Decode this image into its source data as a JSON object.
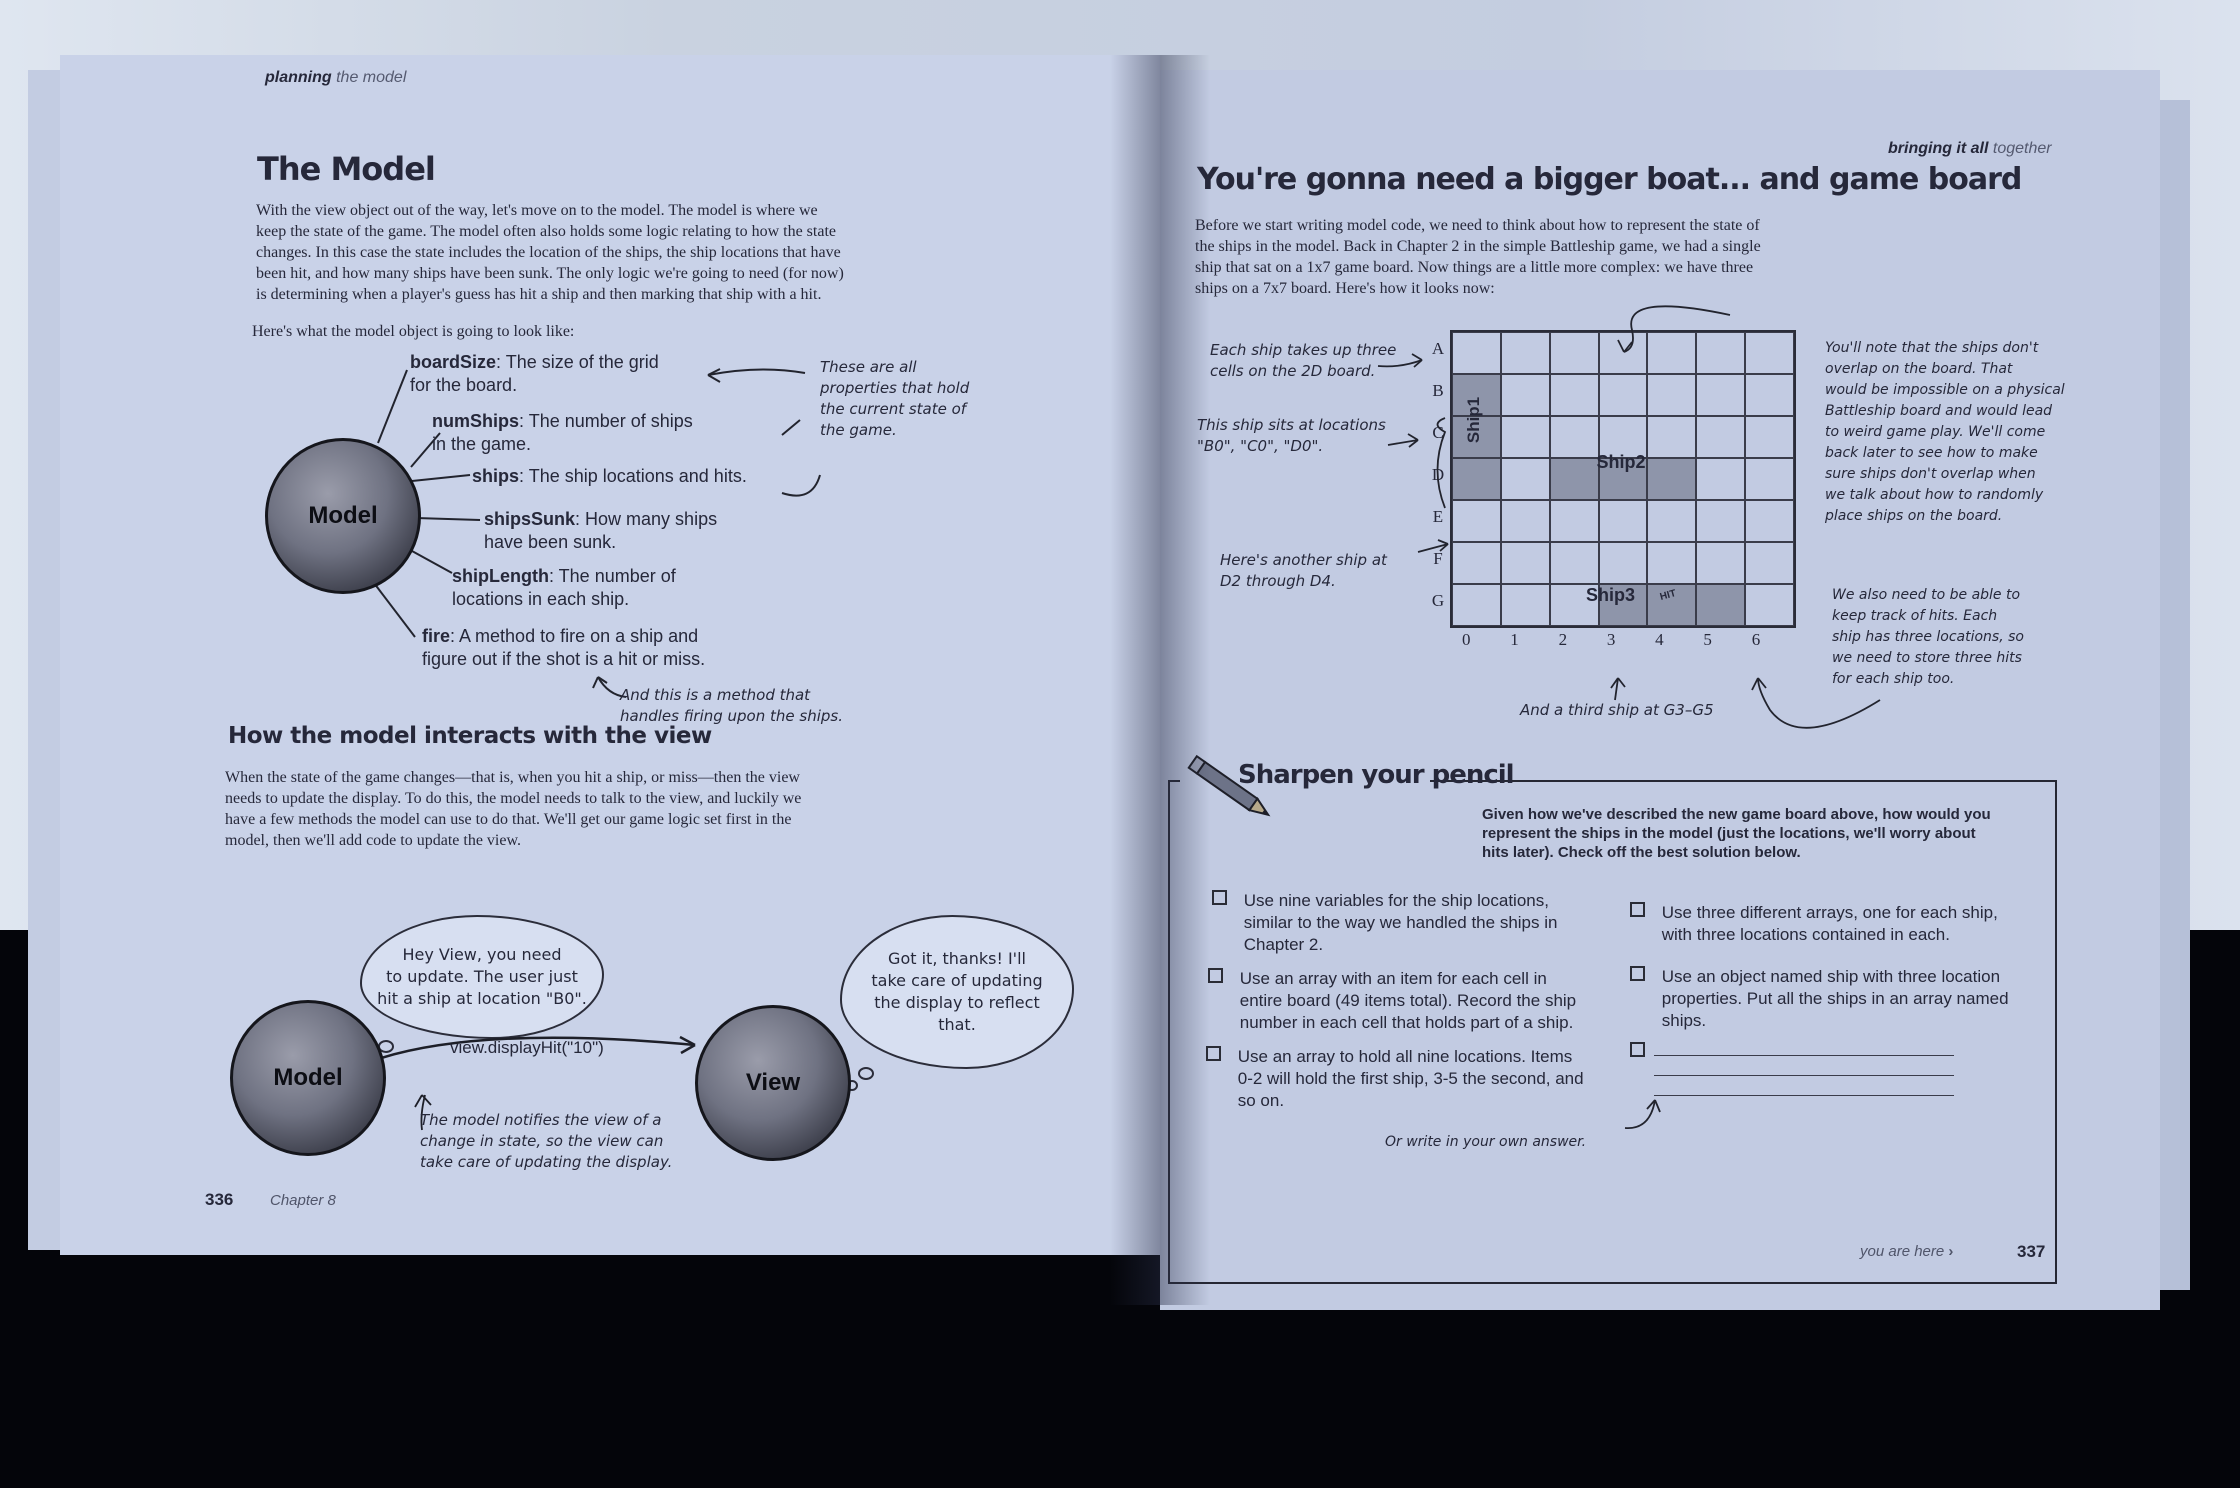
{
  "left_page": {
    "running_head": {
      "main": "planning",
      "sub": "the model"
    },
    "title": "The Model",
    "intro": [
      "With the view object out of the way, let's move on to the model. The model is where we",
      "keep the state of the game. The model often also holds some logic relating to how the state",
      "changes. In this case the state includes the location of the ships, the ship locations that have",
      "been hit, and how many ships have been sunk. The only logic we're going to need (for now)",
      "is determining when a player's guess has hit a ship and then marking that ship with a hit."
    ],
    "lead_in": "Here's what the model object is going to look like:",
    "model_label": "Model",
    "properties": [
      {
        "name": "boardSize",
        "desc": ": The size of the grid",
        "desc2": "for the board."
      },
      {
        "name": "numShips",
        "desc": ": The number of ships",
        "desc2": "in the game."
      },
      {
        "name": "ships",
        "desc": ": The ship locations and hits.",
        "desc2": ""
      },
      {
        "name": "shipsSunk",
        "desc": ": How many ships",
        "desc2": "have been sunk."
      },
      {
        "name": "shipLength",
        "desc": ": The number of",
        "desc2": "locations in each ship."
      },
      {
        "name": "fire",
        "desc": ": A method to fire on a ship and",
        "desc2": "figure out if the shot is a hit or miss."
      }
    ],
    "annotation_props": [
      "These are all",
      "properties that hold",
      "the current state of",
      "the game."
    ],
    "annotation_fire": [
      "And this is a method that",
      "handles firing upon the ships."
    ],
    "subhead": "How the model interacts with the view",
    "interact_text": [
      "When the state of the game changes—that is, when you hit a ship, or miss—then the view",
      "needs to update the display. To do this, the model needs to talk to the view, and luckily we",
      "have a few methods the model can use to do that. We'll get our game logic set first in the",
      "model, then we'll add code to update the view."
    ],
    "bubble_model": [
      "Hey View, you need",
      "to update. The user just",
      "hit a ship at location \"B0\"."
    ],
    "bubble_view": [
      "Got it, thanks! I'll",
      "take care of updating",
      "the display to reflect",
      "that."
    ],
    "model_orb": "Model",
    "view_orb": "View",
    "call": "view.displayHit(\"10\")",
    "annotation_call": [
      "The model notifies the view of a",
      "change in state, so the view can",
      "take care of updating the display."
    ],
    "page_number": "336",
    "chapter": "Chapter 8"
  },
  "right_page": {
    "running_head": {
      "main": "bringing it all",
      "sub": "together"
    },
    "title": "You're gonna need a bigger boat... and game board",
    "intro": [
      "Before we start writing model code, we need to think about how to represent the state of",
      "the ships in the model. Back in Chapter 2 in the simple Battleship game, we had a single",
      "ship that sat on a 1x7 game board. Now things are a little more complex: we have three",
      "ships on a 7x7 board. Here's how it looks now:"
    ],
    "board": {
      "rows": [
        "A",
        "B",
        "C",
        "D",
        "E",
        "F",
        "G"
      ],
      "cols": [
        "0",
        "1",
        "2",
        "3",
        "4",
        "5",
        "6"
      ],
      "ships": [
        {
          "name": "Ship1",
          "cells": [
            "B0",
            "C0",
            "D0"
          ]
        },
        {
          "name": "Ship2",
          "cells": [
            "D2",
            "D3",
            "D4"
          ]
        },
        {
          "name": "Ship3",
          "cells": [
            "G3",
            "G4",
            "G5"
          ]
        }
      ],
      "hit_label": "HIT"
    },
    "notes": {
      "takes_up": [
        "Each ship takes up three",
        "cells on the 2D board."
      ],
      "sits_at": [
        "This ship sits at locations",
        "\"B0\", \"C0\", \"D0\"."
      ],
      "another": [
        "Here's another ship at",
        "D2 through D4."
      ],
      "third": "And a third ship at G3–G5",
      "overlap": [
        "You'll note that the ships don't",
        "overlap on the board. That",
        "would be impossible on a physical",
        "Battleship board and would lead",
        "to weird game play. We'll come",
        "back later to see how to make",
        "sure ships don't overlap when",
        "we talk about how to randomly",
        "place ships on the board."
      ],
      "hits": [
        "We also need to be able to",
        "keep track of hits. Each",
        "ship has three locations, so",
        "we need to store three hits",
        "for each ship too."
      ]
    },
    "sharpen": {
      "title": "Sharpen your pencil",
      "question": [
        "Given how we've described the new game board above, how would you",
        "represent the ships in the model (just the locations, we'll worry about",
        "hits later). Check off the best solution below."
      ],
      "choices_left": [
        [
          "Use nine variables for the ship locations,",
          "similar to the way we handled the ships in",
          "Chapter 2."
        ],
        [
          "Use an array with an item for each cell in",
          "entire board (49 items total). Record the ship",
          "number in each cell that holds part of a ship."
        ],
        [
          "Use an array to hold all nine locations. Items",
          "0-2 will hold the first ship, 3-5 the second, and",
          "so on."
        ]
      ],
      "choices_right": [
        [
          "Use three different arrays, one for each ship,",
          "with three locations contained in each."
        ],
        [
          "Use an object named ship with three location",
          "properties. Put all the ships in an array named",
          "ships."
        ]
      ],
      "own_answer": "Or write in your own answer."
    },
    "footer": "you are here",
    "footer_arrow": "›",
    "page_number": "337"
  }
}
